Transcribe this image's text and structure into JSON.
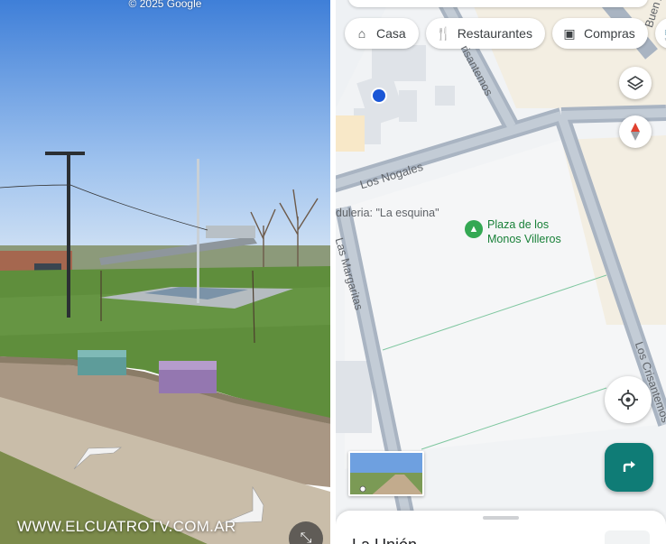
{
  "street_view": {
    "copyright": "© 2025 Google",
    "watermark": "WWW.ELCUATROTV.COM.AR",
    "collapse_icon": "collapse-arrows-icon",
    "nav_arrows": [
      "nav-arrow-left-icon",
      "nav-arrow-right-icon"
    ]
  },
  "map": {
    "chips": [
      {
        "label": "Casa",
        "icon": "home-icon"
      },
      {
        "label": "Restaurantes",
        "icon": "restaurant-icon"
      },
      {
        "label": "Compras",
        "icon": "shopping-bag-icon"
      }
    ],
    "streets": {
      "los_nogales": "Los Nogales",
      "las_margaritas": "Las Margaritas",
      "los_crisantemos": "Los Crisantemos",
      "crisantemos_top": "risantemos",
      "buen_aire": "Buen Ai"
    },
    "place_label": "duleria: \"La esquina\"",
    "poi": {
      "line1": "Plaza de los",
      "line2": "Monos Villeros"
    },
    "sheet_title": "La Unión",
    "colors": {
      "teal": "#0f7c76",
      "poi_green": "#188038",
      "blue_dot": "#1a56d6",
      "road": "#a9b4c2"
    }
  }
}
